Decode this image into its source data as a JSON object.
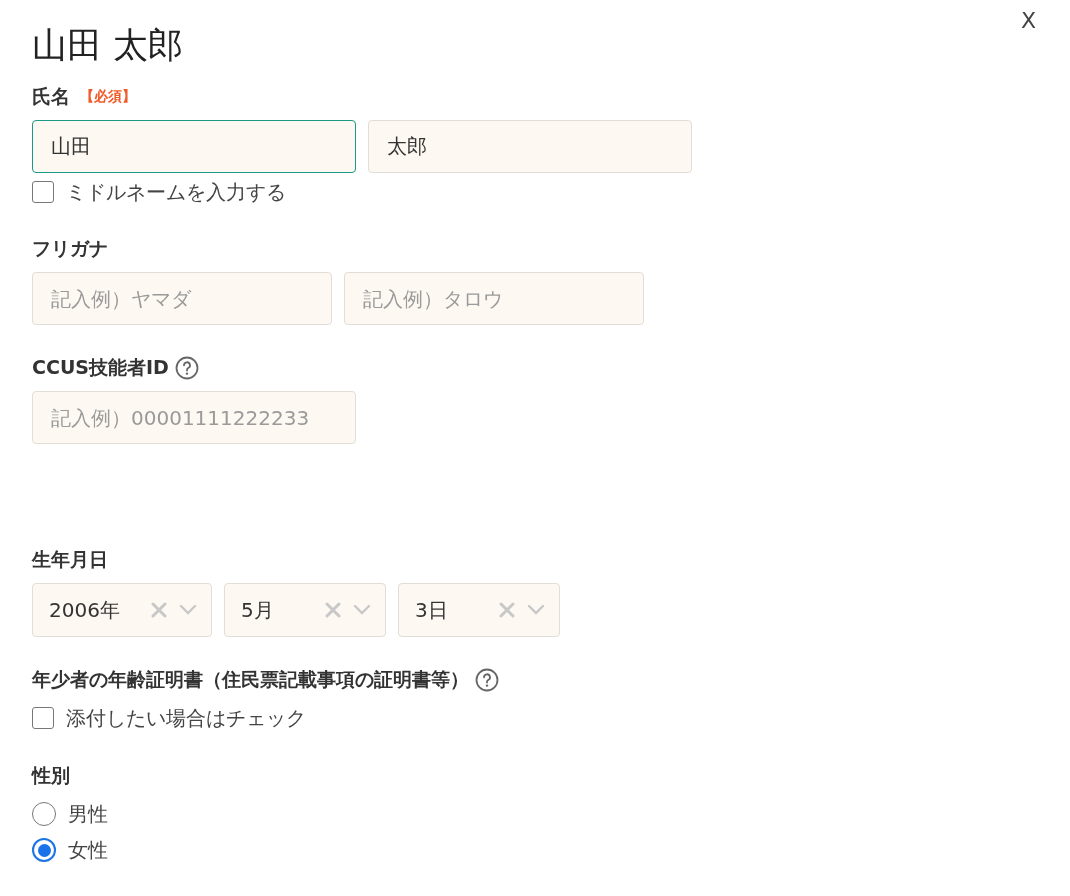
{
  "close_button": {
    "label": "X"
  },
  "title": "山田 太郎",
  "name_section": {
    "label": "氏名",
    "required": "【必須】",
    "fields": [
      {
        "value": "山田",
        "focused": true
      },
      {
        "value": "太郎",
        "focused": false
      }
    ],
    "middle_name": {
      "label": "ミドルネームを入力する",
      "checked": false
    }
  },
  "furigana_section": {
    "label": "フリガナ",
    "fields": [
      {
        "placeholder": "記入例）ヤマダ"
      },
      {
        "placeholder": "記入例）タロウ"
      }
    ]
  },
  "ccus_section": {
    "label": "CCUS技能者ID",
    "help": true,
    "field": {
      "placeholder": "記入例）00001111222233"
    }
  },
  "birthdate_section": {
    "label": "生年月日",
    "selects": [
      {
        "value": "2006年"
      },
      {
        "value": "5月"
      },
      {
        "value": "3日"
      }
    ]
  },
  "age_certificate_section": {
    "label": "年少者の年齢証明書（住民票記載事項の証明書等）",
    "help": true,
    "checkbox": {
      "label": "添付したい場合はチェック",
      "checked": false
    }
  },
  "gender_section": {
    "label": "性別",
    "options": [
      {
        "label": "男性",
        "selected": false
      },
      {
        "label": "女性",
        "selected": true
      }
    ]
  }
}
